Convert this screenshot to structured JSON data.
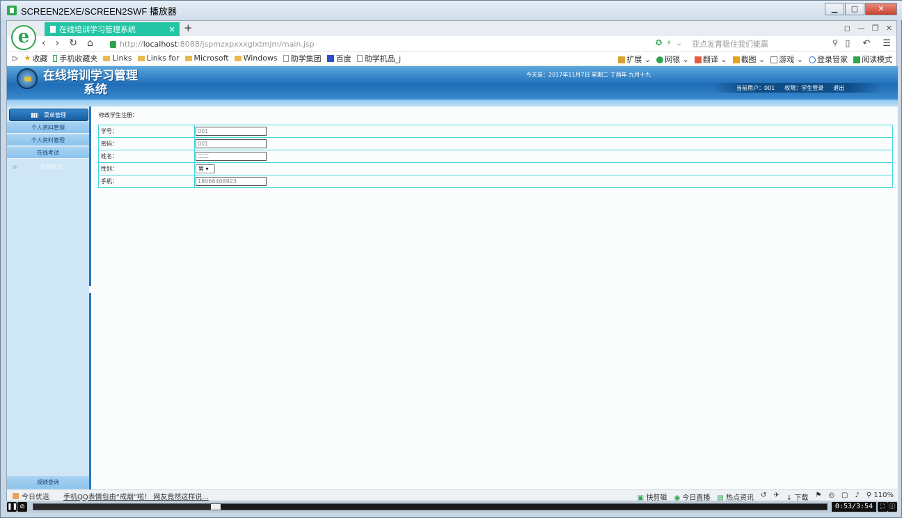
{
  "player": {
    "title": "SCREEN2EXE/SCREEN2SWF 播放器",
    "time": "0:53/3:54",
    "progress": 0.23
  },
  "browser": {
    "logo_letter": "e",
    "tab_title": "在线培训学习管理系统",
    "tab_close": "×",
    "new_tab": "+",
    "url_prefix": "http://",
    "url_host": "localhost",
    "url_rest": ":8088/jspmzxpxxxglxtmjm/main.jsp",
    "search_placeholder": "亚点发育稳住我们能赢",
    "bookmarks": [
      "收藏",
      "手机收藏夹",
      "Links",
      "Links for",
      "Microsoft",
      "Windows",
      "助学集团",
      "百度",
      "助学机品_j"
    ],
    "bookmarks_right": [
      "扩展",
      "网银",
      "翻译",
      "截图",
      "游戏",
      "登录管家",
      "阅读模式"
    ]
  },
  "page": {
    "system_title_line1": "在线培训学习管理",
    "system_title_line2": "系统",
    "today": "今天是：2017年11月7日 星期二 丁酉年 九月十九",
    "current_user_label": "当前用户：",
    "current_user": "001",
    "role_label": "权限：",
    "role": "学生登录",
    "logout": "退出"
  },
  "sidebar": {
    "header": "菜单管理",
    "items": [
      "个人资料管理",
      "个人资料管理",
      "在线考试"
    ],
    "sub_item": "在线考试",
    "bottom": "成绩查询"
  },
  "form": {
    "title": "修改学生注册：",
    "rows": [
      {
        "label": "学号：",
        "value": "001"
      },
      {
        "label": "密码：",
        "value": "001"
      },
      {
        "label": "姓名：",
        "value": "二二"
      },
      {
        "label": "性别：",
        "value": "男"
      },
      {
        "label": "手机：",
        "value": "18066408923"
      }
    ]
  },
  "status": {
    "left": "今日优选",
    "news": "手机QQ表情包由“戒烟”啦！ 网友竟然这样说...",
    "right": [
      "快剪辑",
      "今日直播",
      "热点资讯",
      "下载",
      "110%"
    ]
  }
}
